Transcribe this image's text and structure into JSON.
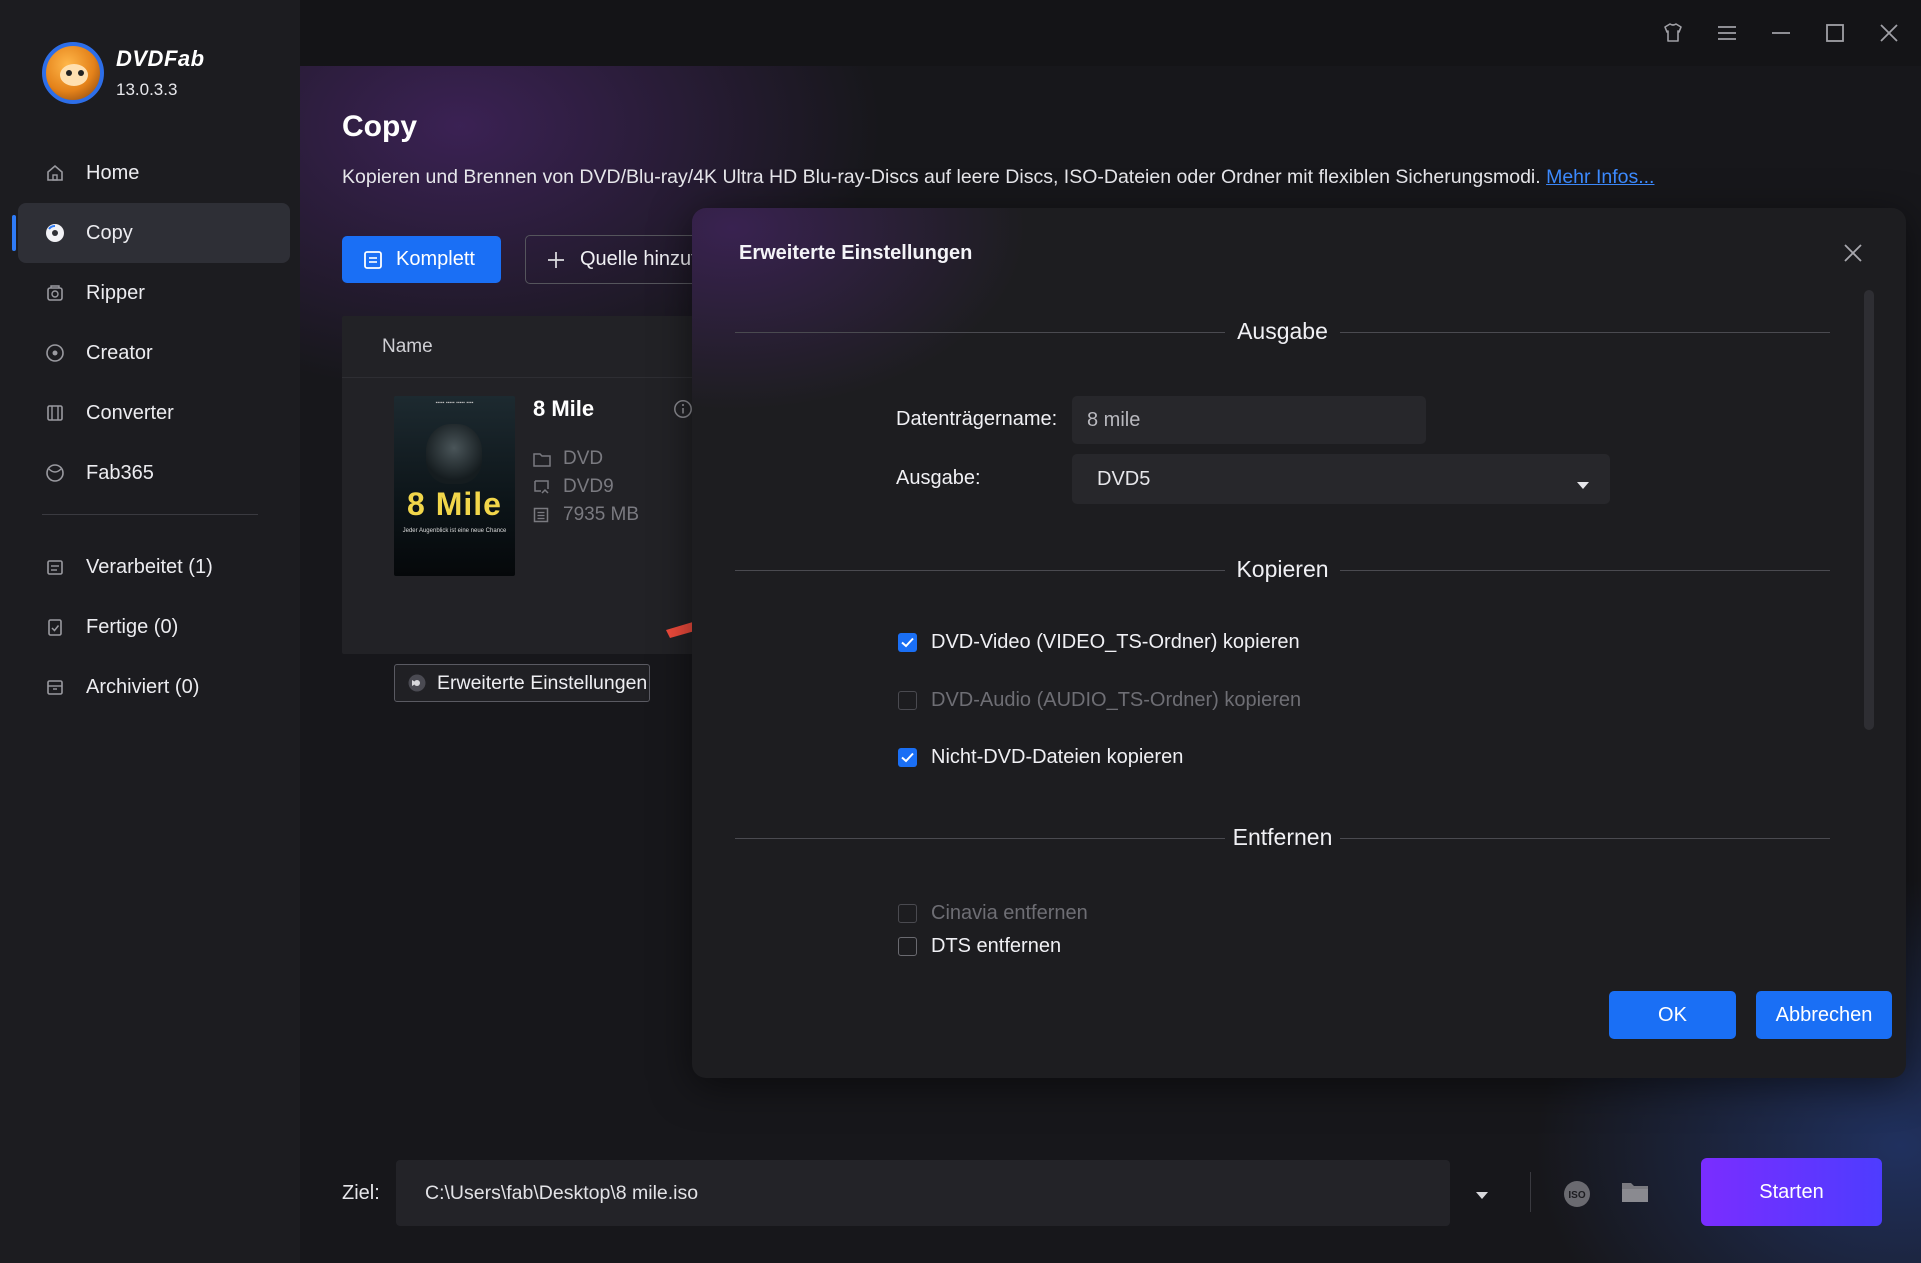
{
  "app": {
    "brand": "DVDFab",
    "version": "13.0.3.3"
  },
  "sidebar": {
    "items": [
      {
        "label": "Home",
        "icon": "home-icon"
      },
      {
        "label": "Copy",
        "icon": "copy-disc-icon",
        "active": true
      },
      {
        "label": "Ripper",
        "icon": "ripper-icon"
      },
      {
        "label": "Creator",
        "icon": "creator-icon"
      },
      {
        "label": "Converter",
        "icon": "converter-icon"
      },
      {
        "label": "Fab365",
        "icon": "fab365-icon"
      }
    ],
    "queue": [
      {
        "label": "Verarbeitet (1)",
        "icon": "processing-icon"
      },
      {
        "label": "Fertige (0)",
        "icon": "finished-icon"
      },
      {
        "label": "Archiviert (0)",
        "icon": "archive-icon"
      }
    ]
  },
  "main": {
    "title": "Copy",
    "description": "Kopieren und Brennen von DVD/Blu-ray/4K Ultra HD Blu-ray-Discs auf leere Discs, ISO-Dateien oder Ordner mit flexiblen Sicherungsmodi.",
    "more_link": "Mehr Infos...",
    "mode_button": "Komplett",
    "add_source_button": "Quelle hinzufügen",
    "list_header_name": "Name",
    "movie": {
      "title": "8 Mile",
      "poster_title": "8 Mile",
      "poster_tagline": "Jeder Augenblick ist eine neue Chance",
      "source_type": "DVD",
      "target_type": "DVD9",
      "size": "7935 MB",
      "advanced_button": "Erweiterte Einstellungen"
    },
    "target_label": "Ziel:",
    "target_path": "C:\\Users\\fab\\Desktop\\8 mile.iso",
    "start_button": "Starten"
  },
  "dialog": {
    "title": "Erweiterte Einstellungen",
    "sections": {
      "output": "Ausgabe",
      "copy": "Kopieren",
      "remove": "Entfernen"
    },
    "volume_label": "Datenträgername:",
    "volume_value": "8 mile",
    "output_label": "Ausgabe:",
    "output_value": "DVD5",
    "checkboxes": {
      "dvd_video": {
        "label": "DVD-Video (VIDEO_TS-Ordner) kopieren",
        "checked": true
      },
      "dvd_audio": {
        "label": "DVD-Audio (AUDIO_TS-Ordner) kopieren",
        "checked": false,
        "disabled": true
      },
      "non_dvd": {
        "label": "Nicht-DVD-Dateien kopieren",
        "checked": true
      },
      "cinavia": {
        "label": "Cinavia entfernen",
        "checked": false,
        "disabled": true
      },
      "dts": {
        "label": "DTS entfernen",
        "checked": false
      }
    },
    "ok_button": "OK",
    "cancel_button": "Abbrechen"
  },
  "colors": {
    "accent": "#1a6ff5",
    "start_gradient_from": "#7a2dff",
    "start_gradient_to": "#4e3cff",
    "annotation_arrow": "#f04b3c"
  }
}
